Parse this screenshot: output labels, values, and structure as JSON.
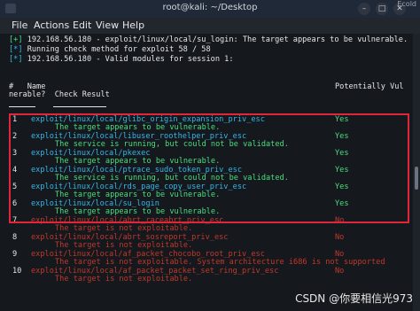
{
  "window": {
    "title": "root@kali: ~/Desktop",
    "corner_label": "Ecold"
  },
  "menu": [
    "File",
    "Actions",
    "Edit",
    "View",
    "Help"
  ],
  "top_lines": [
    {
      "prefix": "[+]",
      "prefix_color": "green",
      "text": " 192.168.56.180 - exploit/linux/local/su_login: The target appears to be vulnerable."
    },
    {
      "prefix": "[*]",
      "prefix_color": "cyan",
      "text": " Running check method for exploit 58 / 58"
    },
    {
      "prefix": "[*]",
      "prefix_color": "cyan",
      "text": " 192.168.56.180 - Valid modules for session 1:"
    }
  ],
  "table": {
    "header_line1_left": "#   Name",
    "header_line1_right": "Potentially Vul",
    "header_line2": "nerable?  Check Result",
    "rows": [
      {
        "num": "1",
        "module": "exploit/linux/local/glibc_origin_expansion_priv_esc",
        "result": "Yes",
        "detail": "The target appears to be vulnerable.",
        "status": "yes"
      },
      {
        "num": "2",
        "module": "exploit/linux/local/libuser_roothelper_priv_esc",
        "result": "Yes",
        "detail": "The service is running, but could not be validated.",
        "status": "yes"
      },
      {
        "num": "3",
        "module": "exploit/linux/local/pkexec",
        "result": "Yes",
        "detail": "The target appears to be vulnerable.",
        "status": "yes"
      },
      {
        "num": "4",
        "module": "exploit/linux/local/ptrace_sudo_token_priv_esc",
        "result": "Yes",
        "detail": "The service is running, but could not be validated.",
        "status": "yes"
      },
      {
        "num": "5",
        "module": "exploit/linux/local/rds_page_copy_user_priv_esc",
        "result": "Yes",
        "detail": "The target appears to be vulnerable.",
        "status": "yes"
      },
      {
        "num": "6",
        "module": "exploit/linux/local/su_login",
        "result": "Yes",
        "detail": "The target appears to be vulnerable.",
        "status": "yes"
      },
      {
        "num": "7",
        "module": "exploit/linux/local/abrt_raceabrt_priv_esc",
        "result": "No",
        "detail": "The target is not exploitable.",
        "status": "no"
      },
      {
        "num": "8",
        "module": "exploit/linux/local/abrt_sosreport_priv_esc",
        "result": "No",
        "detail": "The target is not exploitable.",
        "status": "no"
      },
      {
        "num": "9",
        "module": "exploit/linux/local/af_packet_chocobo_root_priv_esc",
        "result": "No",
        "detail": "The target is not exploitable. System architecture i686 is not supported",
        "status": "no"
      },
      {
        "num": "10",
        "module": "exploit/linux/local/af_packet_packet_set_ring_priv_esc",
        "result": "No",
        "detail": "The target is not exploitable.",
        "status": "no"
      }
    ]
  },
  "watermark": "CSDN @你要相信光973",
  "colors": {
    "highlight_box": "#e0263b",
    "yes": "#4ade80",
    "no": "#c0392b"
  }
}
